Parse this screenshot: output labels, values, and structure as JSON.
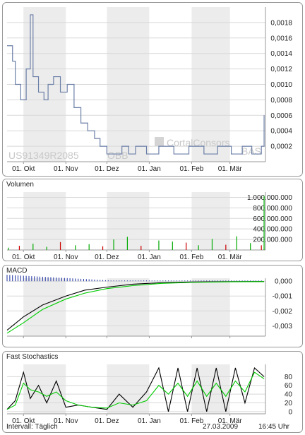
{
  "x_labels": [
    "01. Okt",
    "01. Nov",
    "01. Dez",
    "01. Jan",
    "01. Feb",
    "01. Mär"
  ],
  "watermark": {
    "isin": "US91349R2085",
    "exchange": "OBB",
    "brand": "CortalConsors",
    "brand_suffix": "BAS"
  },
  "footer": {
    "interval": "Intervall: Täglich",
    "date": "27.03.2009",
    "time": "16:45 Uhr"
  },
  "chart_data": [
    {
      "type": "line",
      "title": "",
      "x": [
        "2008-09-19",
        "2008-09-23",
        "2008-09-25",
        "2008-09-29",
        "2008-10-03",
        "2008-10-06",
        "2008-10-08",
        "2008-10-12",
        "2008-10-16",
        "2008-10-19",
        "2008-10-23",
        "2008-10-28",
        "2008-11-02",
        "2008-11-07",
        "2008-11-12",
        "2008-11-17",
        "2008-11-22",
        "2008-11-26",
        "2008-12-01",
        "2008-12-06",
        "2008-12-12",
        "2008-12-17",
        "2008-12-22",
        "2008-12-30",
        "2009-01-08",
        "2009-01-19",
        "2009-01-30",
        "2009-02-10",
        "2009-02-20",
        "2009-03-02",
        "2009-03-10",
        "2009-03-17",
        "2009-03-24",
        "2009-03-26"
      ],
      "series": [
        {
          "values": [
            0.0015,
            0.0013,
            0.001,
            0.0008,
            0.0012,
            0.0019,
            0.0011,
            0.0009,
            0.0008,
            0.001,
            0.0011,
            0.0009,
            0.001,
            0.0007,
            0.0005,
            0.0004,
            0.0003,
            0.0002,
            0.0001,
            0.0001,
            0.0002,
            0.0001,
            0.0002,
            0.0001,
            0.0002,
            0.0001,
            0.0002,
            0.0001,
            0.0002,
            0.0001,
            0.0002,
            0.0001,
            0.0002,
            0.0006
          ],
          "color": "#6b7fa8"
        }
      ],
      "ylim": [
        0,
        0.002
      ],
      "yticks": [
        "0,0002",
        "0,0004",
        "0,0006",
        "0,0008",
        "0,0010",
        "0,0012",
        "0,0014",
        "0,0016",
        "0,0018"
      ],
      "grid": true
    },
    {
      "type": "bar",
      "title": "Volumen",
      "x": [
        "2008-09-20",
        "2008-09-28",
        "2008-10-08",
        "2008-10-18",
        "2008-10-28",
        "2008-11-08",
        "2008-11-18",
        "2008-11-28",
        "2008-12-06",
        "2008-12-16",
        "2008-12-26",
        "2009-01-08",
        "2009-01-18",
        "2009-01-28",
        "2009-02-06",
        "2009-02-16",
        "2009-02-26",
        "2009-03-06",
        "2009-03-16",
        "2009-03-24",
        "2009-03-26"
      ],
      "values": [
        45000000,
        80000000,
        120000000,
        60000000,
        150000000,
        90000000,
        110000000,
        70000000,
        200000000,
        250000000,
        80000000,
        180000000,
        160000000,
        140000000,
        90000000,
        210000000,
        100000000,
        260000000,
        130000000,
        90000000,
        1030000000
      ],
      "up_color": "#00aa00",
      "down_color": "#cc0000",
      "ylim": [
        0,
        1100000000
      ],
      "yticks": [
        "200.000.000",
        "400.000.000",
        "600.000.000",
        "800.000.000",
        "1.000.000.000"
      ],
      "grid": true
    },
    {
      "type": "line",
      "title": "MACD",
      "x": [
        "2008-09-19",
        "2008-10-01",
        "2008-10-15",
        "2008-11-01",
        "2008-11-15",
        "2008-12-01",
        "2008-12-20",
        "2009-01-10",
        "2009-02-01",
        "2009-03-01",
        "2009-03-26"
      ],
      "series": [
        {
          "values": [
            -0.0033,
            -0.0024,
            -0.0016,
            -0.001,
            -0.0006,
            -0.0004,
            -0.0002,
            -0.0001,
            -5e-05,
            -3e-05,
            -2e-05
          ],
          "color": "#000000"
        },
        {
          "values": [
            -0.0035,
            -0.0028,
            -0.0019,
            -0.0012,
            -0.0008,
            -0.0005,
            -0.0003,
            -0.00015,
            -8e-05,
            -4e-05,
            -3e-05
          ],
          "color": "#00cc00"
        }
      ],
      "histogram_color": "#1a2fa0",
      "ylim": [
        -0.0037,
        0.0002
      ],
      "yticks": [
        "-0,003",
        "-0,002",
        "-0,001",
        "0,000"
      ],
      "grid": true
    },
    {
      "type": "line",
      "title": "Fast Stochastics",
      "x": [
        "2008-09-19",
        "2008-09-25",
        "2008-10-01",
        "2008-10-06",
        "2008-10-12",
        "2008-10-18",
        "2008-10-25",
        "2008-11-01",
        "2008-11-10",
        "2008-11-20",
        "2008-12-01",
        "2008-12-10",
        "2008-12-20",
        "2008-12-30",
        "2009-01-08",
        "2009-01-15",
        "2009-01-22",
        "2009-01-29",
        "2009-02-05",
        "2009-02-12",
        "2009-02-19",
        "2009-02-26",
        "2009-03-05",
        "2009-03-12",
        "2009-03-19",
        "2009-03-26"
      ],
      "series": [
        {
          "values": [
            5,
            25,
            90,
            30,
            60,
            20,
            70,
            10,
            15,
            10,
            5,
            40,
            10,
            45,
            100,
            0,
            100,
            0,
            100,
            0,
            100,
            0,
            100,
            20,
            100,
            80
          ],
          "color": "#000000"
        },
        {
          "values": [
            5,
            15,
            65,
            50,
            45,
            35,
            45,
            25,
            15,
            10,
            8,
            20,
            15,
            25,
            60,
            40,
            65,
            35,
            70,
            35,
            65,
            35,
            70,
            45,
            90,
            75
          ],
          "color": "#00cc00"
        }
      ],
      "ylim": [
        -5,
        108
      ],
      "yticks": [
        "0",
        "20",
        "40",
        "60",
        "80"
      ],
      "grid": true
    }
  ]
}
